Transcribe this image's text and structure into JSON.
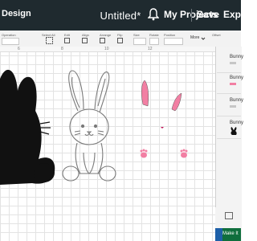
{
  "header": {
    "brand": "Design",
    "title": "Untitled*",
    "my_projects": "My Projects",
    "save": "Save",
    "explore": "Explore"
  },
  "toolbar": {
    "select_all": "Select All",
    "more": "More",
    "labels": [
      "Operation",
      "Size",
      "Rotate",
      "Position",
      "Offset",
      "Align",
      "Arrange",
      "Flip",
      "Edit"
    ]
  },
  "ruler": {
    "marks": [
      "6",
      "8",
      "10",
      "12"
    ]
  },
  "layers": [
    {
      "name": "Bunny"
    },
    {
      "name": "Bunny"
    },
    {
      "name": "Bunny"
    },
    {
      "name": "Bunny"
    }
  ],
  "make_it": "Make It",
  "colors": {
    "header_bg": "#1f2a2f",
    "pink": "#f27fa3",
    "silhouette": "#111111",
    "outline": "#7a7a7a",
    "make_it": "#0f6e3d"
  },
  "icons": [
    "bell-icon",
    "select-all-icon",
    "chevron-icon"
  ]
}
